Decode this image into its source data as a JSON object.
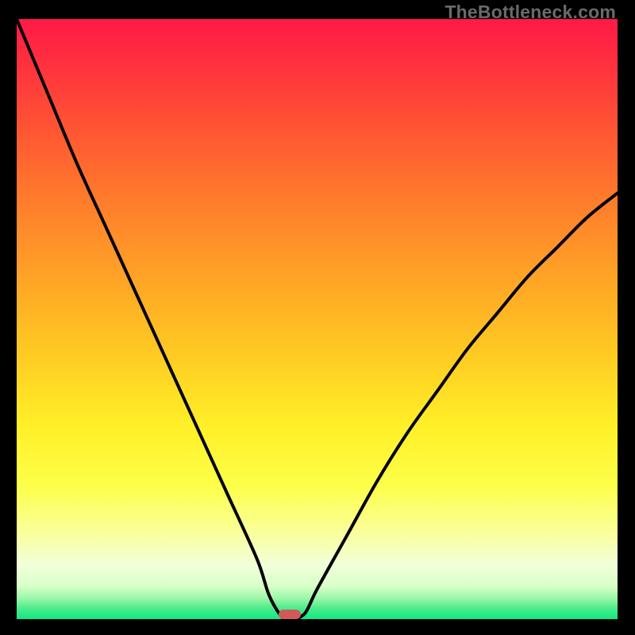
{
  "watermark": "TheBottleneck.com",
  "chart_data": {
    "type": "line",
    "title": "",
    "xlabel": "",
    "ylabel": "",
    "xlim": [
      0,
      100
    ],
    "ylim": [
      0,
      100
    ],
    "series": [
      {
        "name": "bottleneck-curve",
        "x": [
          0,
          5,
          10,
          15,
          20,
          25,
          30,
          35,
          40,
          42,
          44,
          45,
          46,
          48,
          50,
          55,
          60,
          65,
          70,
          75,
          80,
          85,
          90,
          95,
          100
        ],
        "values": [
          100,
          88,
          76,
          65,
          54,
          43,
          32,
          21,
          10,
          4,
          0.5,
          0,
          0,
          1,
          5,
          14,
          23,
          31,
          38,
          45,
          51,
          57,
          62,
          67,
          71
        ]
      }
    ],
    "marker": {
      "x_percent": 45.5,
      "y_percent": 99.2,
      "color": "#d05a5a"
    },
    "gradient_stops": [
      {
        "offset": 0.0,
        "color": "#ff1a47"
      },
      {
        "offset": 0.07,
        "color": "#ff2f3f"
      },
      {
        "offset": 0.18,
        "color": "#ff5433"
      },
      {
        "offset": 0.3,
        "color": "#ff7b2c"
      },
      {
        "offset": 0.43,
        "color": "#ffa326"
      },
      {
        "offset": 0.56,
        "color": "#ffcb22"
      },
      {
        "offset": 0.68,
        "color": "#fff028"
      },
      {
        "offset": 0.78,
        "color": "#fcff4a"
      },
      {
        "offset": 0.86,
        "color": "#faffa0"
      },
      {
        "offset": 0.91,
        "color": "#f1ffda"
      },
      {
        "offset": 0.945,
        "color": "#d9ffc9"
      },
      {
        "offset": 0.965,
        "color": "#9cf7a9"
      },
      {
        "offset": 0.982,
        "color": "#4cec8b"
      },
      {
        "offset": 1.0,
        "color": "#10e884"
      }
    ]
  }
}
